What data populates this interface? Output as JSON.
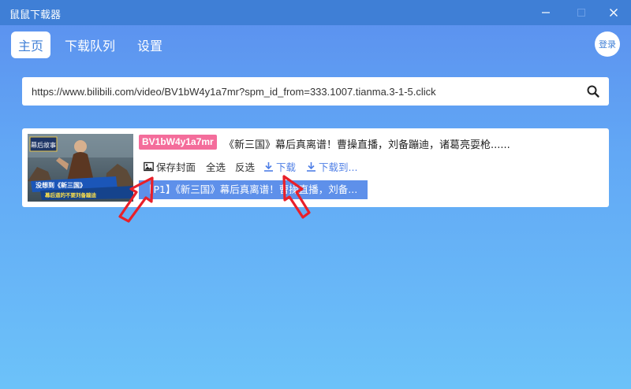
{
  "window": {
    "title": "鼠鼠下载器"
  },
  "nav": {
    "tabs": [
      {
        "label": "主页"
      },
      {
        "label": "下载队列"
      },
      {
        "label": "设置"
      }
    ],
    "login_label": "登录"
  },
  "search": {
    "value": "https://www.bilibili.com/video/BV1bW4y1a7mr?spm_id_from=333.1007.tianma.3-1-5.click"
  },
  "video": {
    "bvid": "BV1bW4y1a7mr",
    "title": "《新三国》幕后真离谱！曹操直播，刘备蹦迪，诸葛亮耍枪......",
    "actions": {
      "save_cover": "保存封面",
      "select_all": "全选",
      "invert": "反选",
      "download": "下载",
      "download_to": "下载到..."
    },
    "thumbnail": {
      "tag_text": "幕后故事",
      "caption1": "没想到《新三国》",
      "caption2": "幕后道的不要刘备蹦迪"
    },
    "parts": [
      {
        "label": "【P1】《新三国》幕后真离谱！曹操直播，刘备..."
      }
    ]
  },
  "colors": {
    "accent": "#3f7fd6",
    "bvid_badge": "#f46d9b",
    "part_bg": "#5e90ea",
    "annotation_arrow": "#e8202a"
  }
}
